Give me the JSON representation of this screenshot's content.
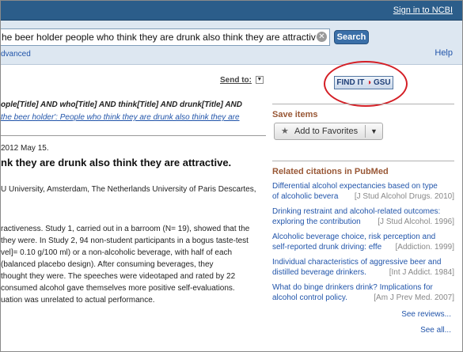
{
  "header": {
    "signin": "Sign in to NCBI"
  },
  "search": {
    "value": "he beer holder people who think they are drunk also think they are attractiv",
    "button": "Search",
    "advanced": "dvanced",
    "help": "Help"
  },
  "main": {
    "send_to": "Send to:",
    "query": "ople[Title] AND who[Title] AND think[Title] AND drunk[Title] AND",
    "query_link": "the beer holder': People who think they are drunk also think they are",
    "date": "2012 May 15.",
    "title": "nk they are drunk also think they are attractive.",
    "affiliation": "U University, Amsterdam, The Netherlands University of Paris Descartes,",
    "abstract_lines": [
      "ractiveness. Study 1, carried out in a barroom (N= 19), showed that the",
      " they were. In Study 2, 94 non-student participants in a bogus taste-test",
      "vel]= 0.10 g/100 ml) or a non-alcoholic beverage, with half of each",
      "(balanced placebo design). After consuming beverages, they",
      "thought they were. The speeches were videotaped and rated by 22",
      " consumed alcohol gave themselves more positive self-evaluations.",
      "uation was unrelated to actual performance."
    ]
  },
  "sidebar": {
    "findit_pre": "FIND IT ",
    "findit_o": "◑",
    "findit_post": " GSU",
    "save_items": "Save items",
    "add_favorites": "Add to Favorites",
    "related_heading": "Related citations in PubMed",
    "citations": [
      {
        "line1": "Differential alcohol expectancies based on type",
        "line2": "of alcoholic bevera",
        "journal": "[J Stud Alcohol Drugs. 2010]"
      },
      {
        "line1": "Drinking restraint and alcohol-related outcomes:",
        "line2": "exploring the contribution",
        "journal": "[J Stud Alcohol. 1996]"
      },
      {
        "line1": "Alcoholic beverage choice, risk perception and",
        "line2": "self-reported drunk driving: effe",
        "journal": "[Addiction. 1999]"
      },
      {
        "line1": "Individual characteristics of aggressive beer and",
        "line2": "distilled beverage drinkers.",
        "journal": "[Int J Addict. 1984]"
      },
      {
        "line1": "What do binge drinkers drink? Implications for",
        "line2": "alcohol control policy.",
        "journal": "[Am J Prev Med. 2007]"
      }
    ],
    "see_reviews": "See reviews...",
    "see_all": "See all..."
  }
}
